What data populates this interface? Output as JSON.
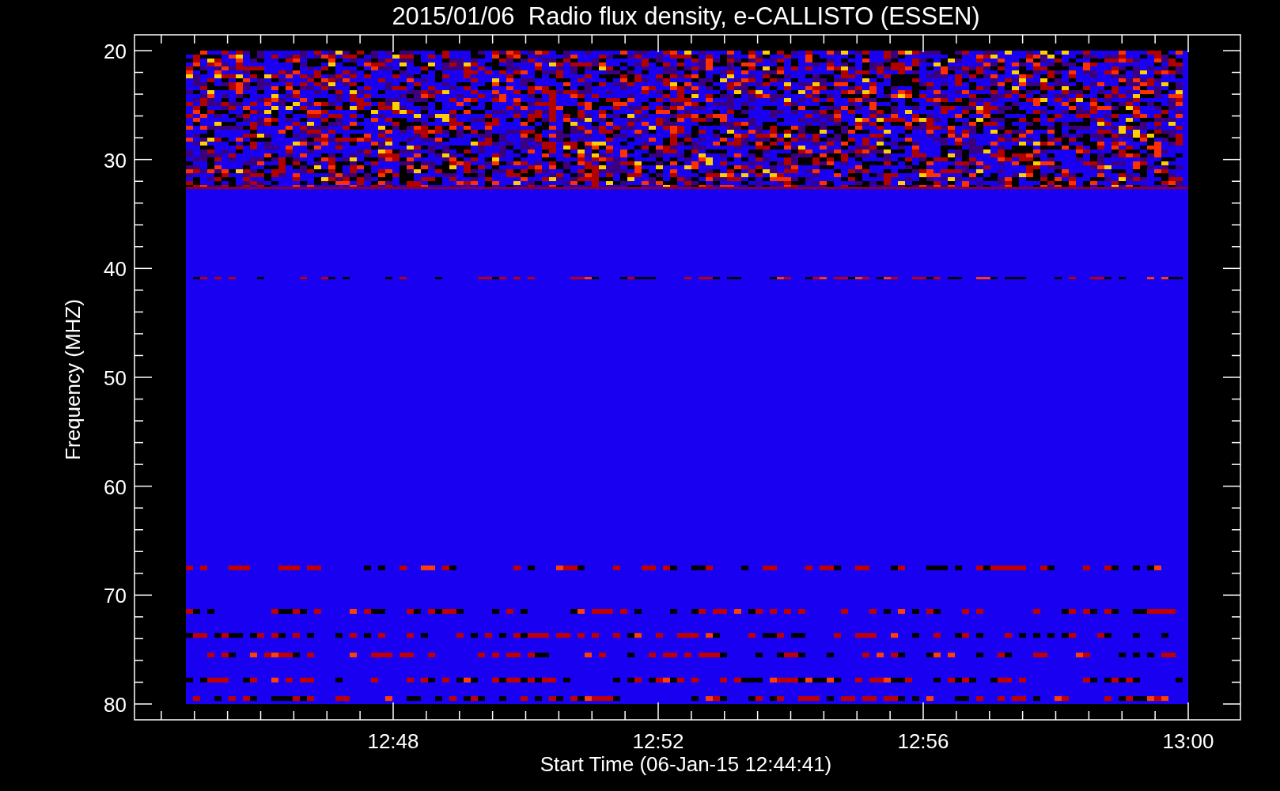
{
  "title": "2015/01/06  Radio flux density, e-CALLISTO (ESSEN)",
  "y_axis": {
    "label": "Frequency (MHZ)",
    "ticks": [
      "20",
      "30",
      "40",
      "50",
      "60",
      "70",
      "80"
    ]
  },
  "x_axis": {
    "label": "Start Time (06-Jan-15 12:44:41)",
    "ticks": [
      "12:48",
      "12:52",
      "12:56",
      "13:00"
    ]
  }
}
